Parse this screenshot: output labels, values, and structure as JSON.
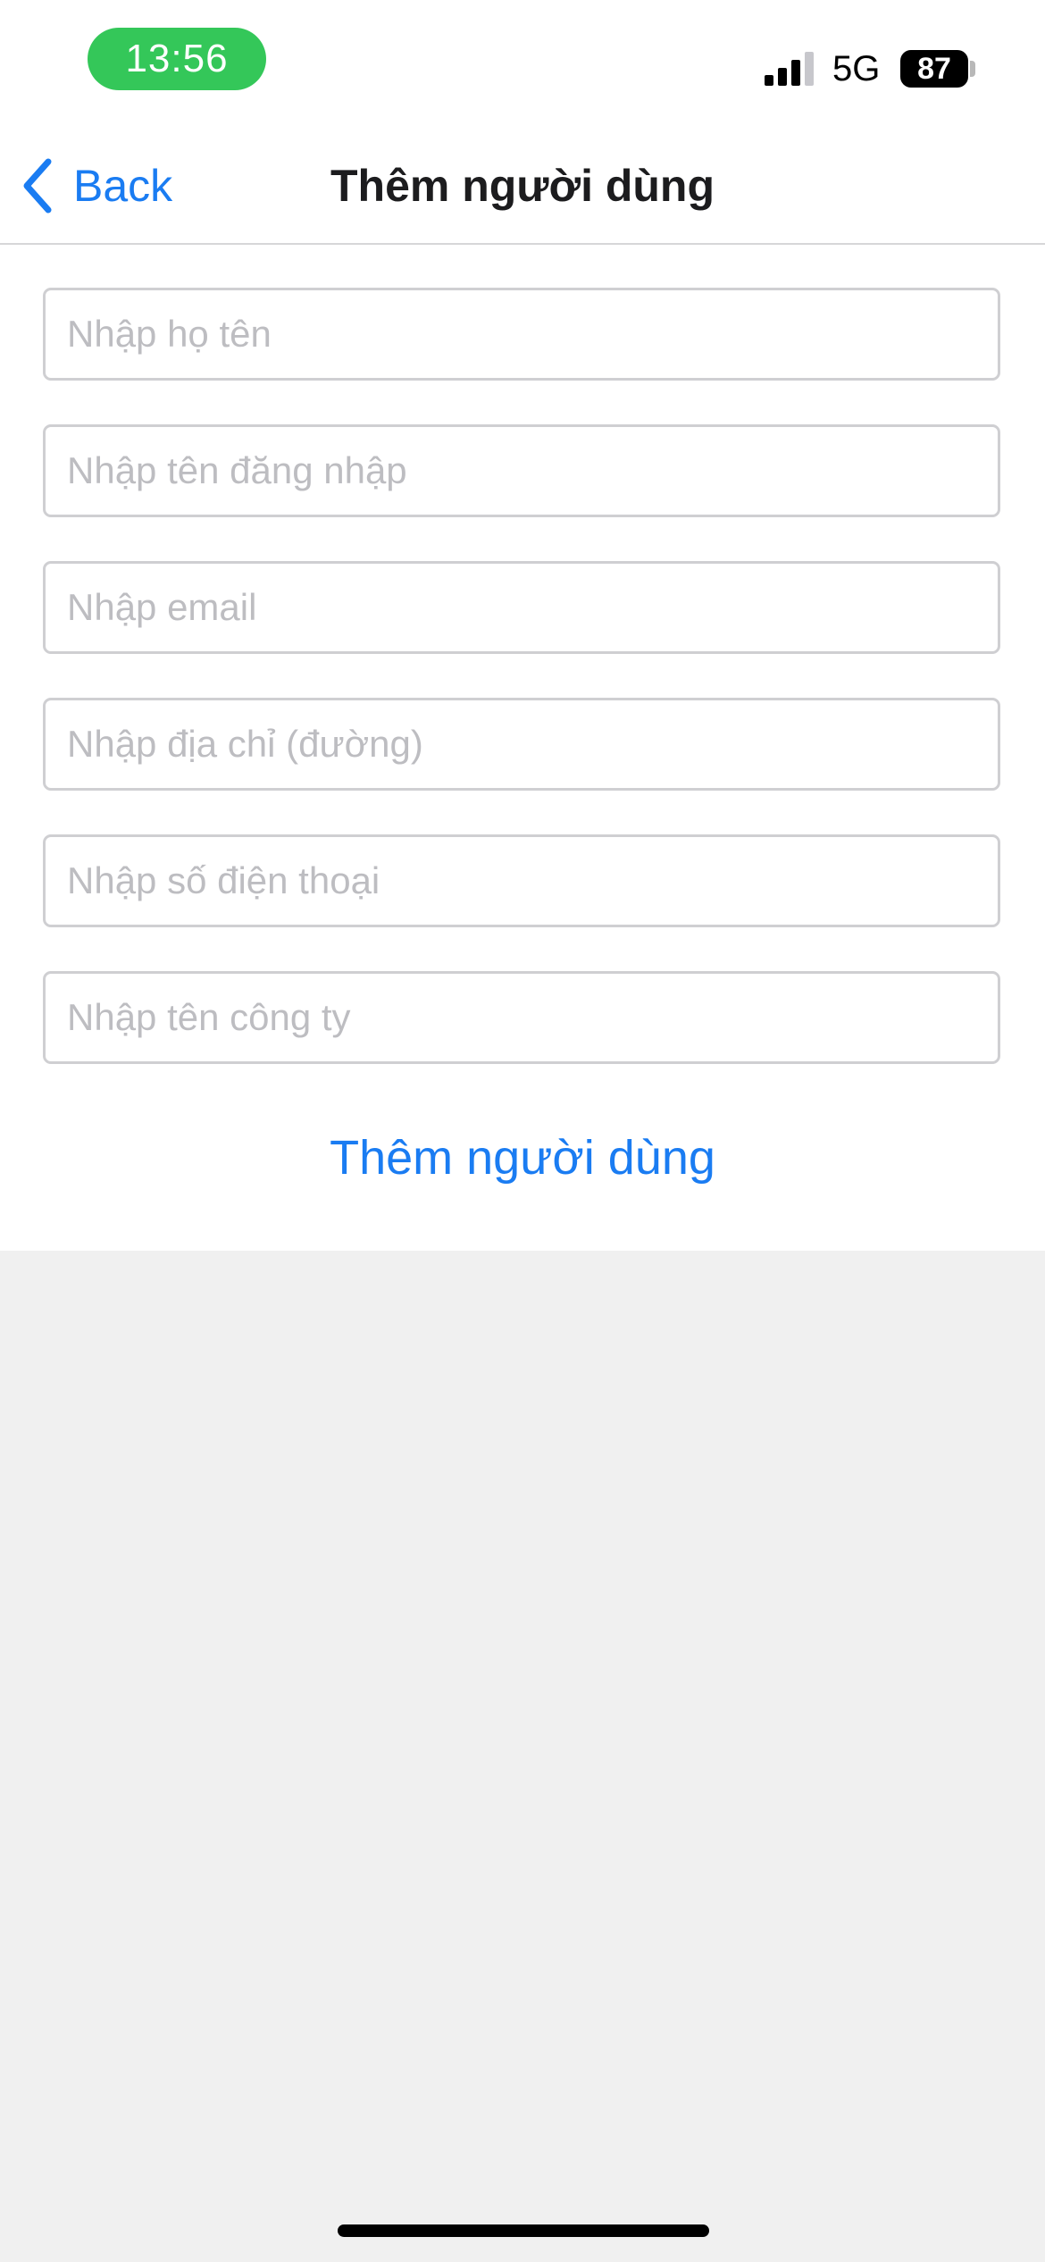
{
  "status_bar": {
    "time": "13:56",
    "network": "5G",
    "battery_percent": "87",
    "signal_bars_active": 3,
    "signal_bars_total": 4,
    "time_pill_color": "#34c759"
  },
  "nav": {
    "back_label": "Back",
    "title": "Thêm người dùng",
    "back_icon": "chevron-left-icon"
  },
  "form": {
    "fields": [
      {
        "placeholder": "Nhập họ tên",
        "value": ""
      },
      {
        "placeholder": "Nhập tên đăng nhập",
        "value": ""
      },
      {
        "placeholder": "Nhập email",
        "value": ""
      },
      {
        "placeholder": "Nhập địa chỉ (đường)",
        "value": ""
      },
      {
        "placeholder": "Nhập số điện thoại",
        "value": ""
      },
      {
        "placeholder": "Nhập tên công ty",
        "value": ""
      }
    ],
    "submit_label": "Thêm người dùng"
  },
  "colors": {
    "accent": "#1a7cf2",
    "background": "#f0f0f0",
    "surface": "#ffffff"
  }
}
